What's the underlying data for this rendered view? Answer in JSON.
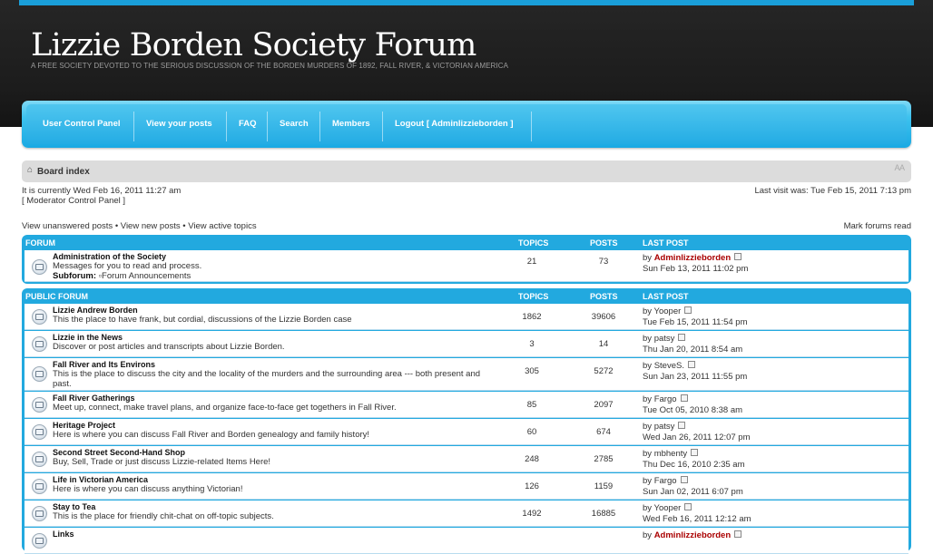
{
  "site": {
    "title": "Lizzie Borden Society Forum",
    "description": "A free society devoted to the serious discussion of the Borden murders of 1892, Fall River, & Victorian America"
  },
  "nav": {
    "items": [
      "User Control Panel",
      "View your posts",
      "FAQ",
      "Search",
      "Members",
      "Logout [ Adminlizzieborden ]"
    ]
  },
  "breadcrumb": {
    "home_icon": "home-icon",
    "label": "Board index",
    "font_resize": "A A"
  },
  "info": {
    "current_time": "It is currently Wed Feb 16, 2011 11:27 am",
    "mcp": "[ Moderator Control Panel ]",
    "last_visit": "Last visit was: Tue Feb 15, 2011 7:13 pm",
    "view_unanswered": "View unanswered posts",
    "view_new": "View new posts",
    "view_active": "View active topics",
    "bullet": "•",
    "mark_read": "Mark forums read"
  },
  "columns": {
    "topics": "TOPICS",
    "posts": "POSTS",
    "last_post": "LAST POST"
  },
  "sections": [
    {
      "name": "FORUM",
      "forums": [
        {
          "title": "Administration of the Society",
          "desc": "Messages for you to read and process.",
          "subforum_label": "Subforum:",
          "subforum_name": "Forum Announcements",
          "topics": "21",
          "posts": "73",
          "by": "by",
          "author": "Adminlizzieborden",
          "admin": true,
          "date": "Sun Feb 13, 2011 11:02 pm"
        }
      ]
    },
    {
      "name": "PUBLIC FORUM",
      "forums": [
        {
          "title": "Lizzie Andrew Borden",
          "desc": "This the place to have frank, but cordial, discussions of the Lizzie Borden case",
          "topics": "1862",
          "posts": "39606",
          "by": "by",
          "author": "Yooper",
          "admin": false,
          "date": "Tue Feb 15, 2011 11:54 pm"
        },
        {
          "title": "Lizzie in the News",
          "desc": "Discover or post articles and transcripts about Lizzie Borden.",
          "topics": "3",
          "posts": "14",
          "by": "by",
          "author": "patsy",
          "admin": false,
          "date": "Thu Jan 20, 2011 8:54 am"
        },
        {
          "title": "Fall River and Its Environs",
          "desc": "This is the place to discuss the city and the locality of the murders and the surrounding area --- both present and past.",
          "topics": "305",
          "posts": "5272",
          "by": "by",
          "author": "SteveS.",
          "admin": false,
          "date": "Sun Jan 23, 2011 11:55 pm"
        },
        {
          "title": "Fall River Gatherings",
          "desc": "Meet up, connect, make travel plans, and organize face-to-face get togethers in Fall River.",
          "topics": "85",
          "posts": "2097",
          "by": "by",
          "author": "Fargo",
          "admin": false,
          "date": "Tue Oct 05, 2010 8:38 am"
        },
        {
          "title": "Heritage Project",
          "desc": "Here is where you can discuss Fall River and Borden genealogy and family history!",
          "topics": "60",
          "posts": "674",
          "by": "by",
          "author": "patsy",
          "admin": false,
          "date": "Wed Jan 26, 2011 12:07 pm"
        },
        {
          "title": "Second Street Second-Hand Shop",
          "desc": "Buy, Sell, Trade or just discuss Lizzie-related Items Here!",
          "topics": "248",
          "posts": "2785",
          "by": "by",
          "author": "mbhenty",
          "admin": false,
          "date": "Thu Dec 16, 2010 2:35 am"
        },
        {
          "title": "Life in Victorian America",
          "desc": "Here is where you can discuss anything Victorian!",
          "topics": "126",
          "posts": "1159",
          "by": "by",
          "author": "Fargo",
          "admin": false,
          "date": "Sun Jan 02, 2011 6:07 pm"
        },
        {
          "title": "Stay to Tea",
          "desc": "This is the place for friendly chit-chat on off-topic subjects.",
          "topics": "1492",
          "posts": "16885",
          "by": "by",
          "author": "Yooper",
          "admin": false,
          "date": "Wed Feb 16, 2011 12:12 am"
        },
        {
          "title": "Links",
          "desc": "",
          "topics": "",
          "posts": "",
          "by": "by",
          "author": "Adminlizzieborden",
          "admin": true,
          "date": ""
        }
      ]
    }
  ]
}
